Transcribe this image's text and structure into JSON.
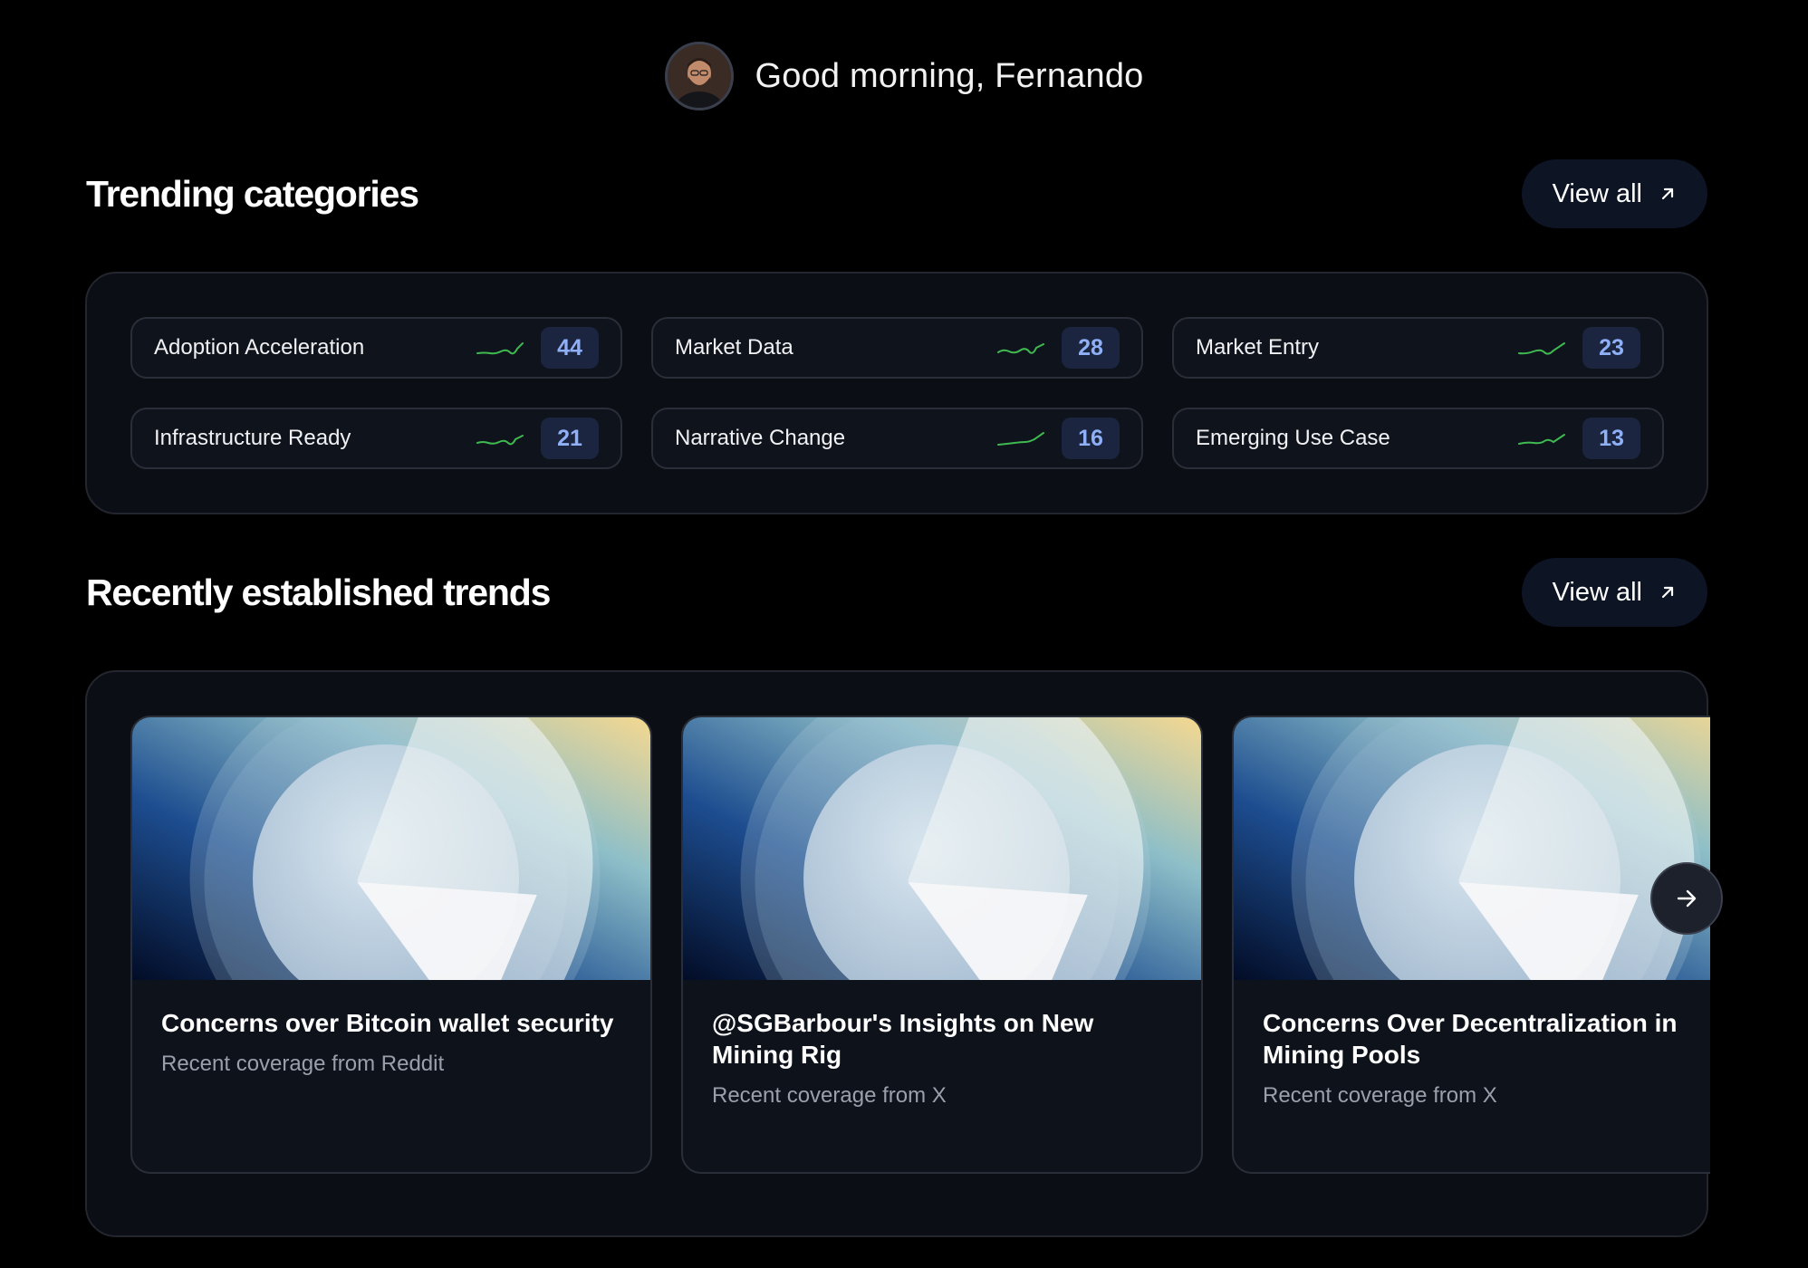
{
  "greeting": {
    "text": "Good morning, Fernando"
  },
  "trending": {
    "title": "Trending categories",
    "view_all_label": "View all",
    "items": [
      {
        "label": "Adoption Acceleration",
        "count": "44"
      },
      {
        "label": "Market Data",
        "count": "28"
      },
      {
        "label": "Market Entry",
        "count": "23"
      },
      {
        "label": "Infrastructure Ready",
        "count": "21"
      },
      {
        "label": "Narrative Change",
        "count": "16"
      },
      {
        "label": "Emerging Use Case",
        "count": "13"
      }
    ]
  },
  "trends": {
    "title": "Recently established trends",
    "view_all_label": "View all",
    "cards": [
      {
        "title": "Concerns over Bitcoin wallet security",
        "subtitle": "Recent coverage from Reddit"
      },
      {
        "title": "@SGBarbour's Insights on New Mining Rig",
        "subtitle": "Recent coverage from X"
      },
      {
        "title": "Concerns Over Decentralization in Mining Pools",
        "subtitle": "Recent coverage from X"
      }
    ]
  },
  "colors": {
    "background": "#000000",
    "panel": "#0b0e15",
    "count_badge_bg": "#1b2540",
    "count_badge_text": "#8fb0f6",
    "sparkline": "#3fb950"
  },
  "icons": {
    "view_all": "arrow-up-right-icon",
    "next": "arrow-right-icon",
    "chip": "sparkline-icon"
  }
}
